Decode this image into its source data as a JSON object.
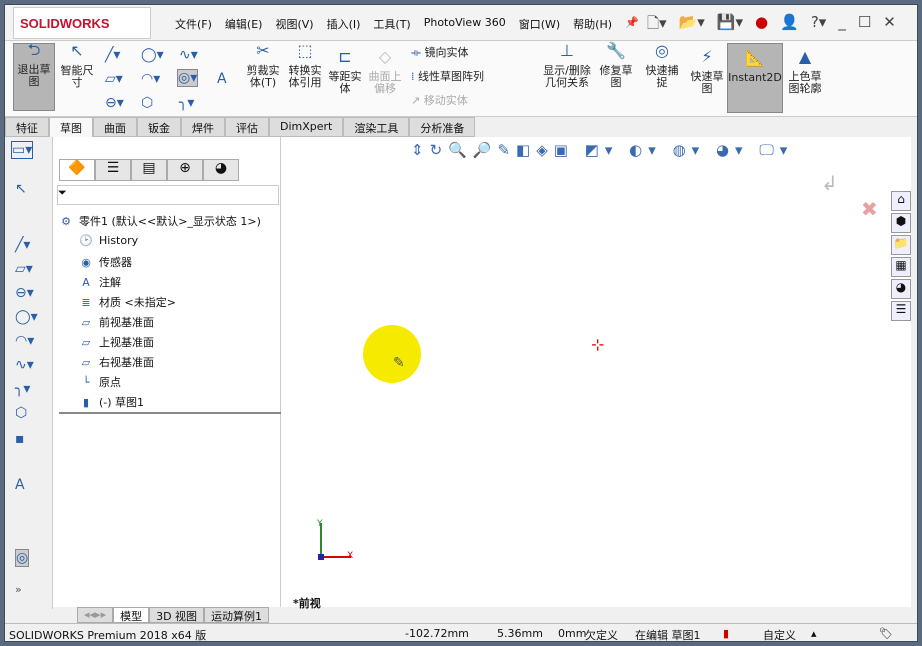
{
  "app": {
    "logo": "SOLIDWORKS"
  },
  "menu": [
    "文件(F)",
    "编辑(E)",
    "视图(V)",
    "插入(I)",
    "工具(T)",
    "PhotoView 360",
    "窗口(W)",
    "帮助(H)"
  ],
  "ribbon": {
    "exit_sketch": "退出草图",
    "smart_dim": "智能尺寸",
    "trim": "剪裁实体(T)",
    "convert": "转换实体引用",
    "offset": "等距实体",
    "surface_offset": "曲面上偏移",
    "mirror": "镜向实体",
    "linear_pattern": "线性草图阵列",
    "move": "移动实体",
    "relations": "显示/删除几何关系",
    "repair": "修复草图",
    "quick_snap": "快速捕捉",
    "rapid_sketch": "快速草图",
    "instant2d": "Instant2D",
    "shaded": "上色草图轮廓"
  },
  "tabs": [
    "特征",
    "草图",
    "曲面",
    "钣金",
    "焊件",
    "评估",
    "DimXpert",
    "渲染工具",
    "分析准备"
  ],
  "active_tab": "草图",
  "tree": {
    "root": "零件1 (默认<<默认>_显示状态 1>)",
    "items": [
      "History",
      "传感器",
      "注解",
      "材质 <未指定>",
      "前视基准面",
      "上视基准面",
      "右视基准面",
      "原点",
      "(-) 草图1"
    ]
  },
  "viewport": {
    "view_label": "*前视",
    "axis_x": "X",
    "axis_y": "Y"
  },
  "bottom_tabs": [
    "模型",
    "3D 视图",
    "运动算例1"
  ],
  "status": {
    "product": "SOLIDWORKS Premium 2018 x64 版",
    "x": "-102.72mm",
    "y": "5.36mm",
    "z": "0mm",
    "state": "欠定义",
    "editing": "在编辑 草图1",
    "units": "自定义"
  }
}
